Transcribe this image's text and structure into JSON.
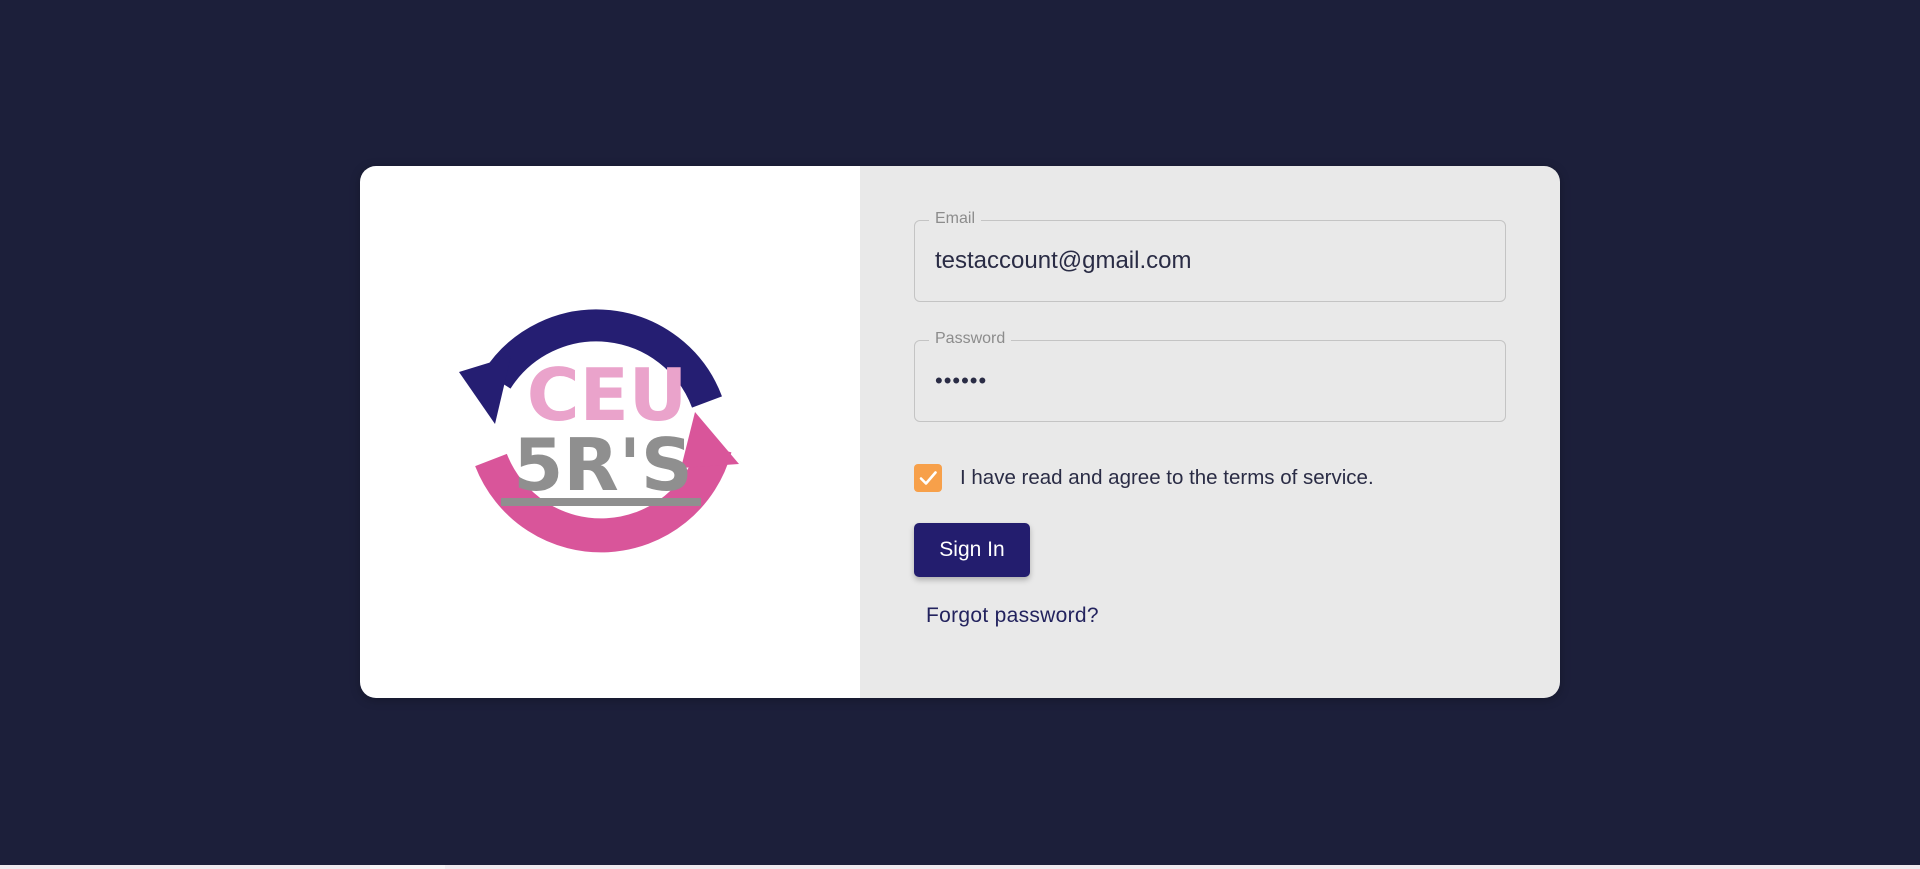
{
  "login": {
    "email": {
      "label": "Email",
      "value": "testaccount@gmail.com"
    },
    "password": {
      "label": "Password",
      "value": "••••••"
    },
    "terms": {
      "checked": true,
      "text": "I have read and agree to the terms of service."
    },
    "sign_in_label": "Sign In",
    "forgot_password_label": "Forgot password?"
  },
  "logo": {
    "line1": "CEU",
    "line2": "5R'S"
  },
  "colors": {
    "background": "#1c1f3a",
    "primary": "#231d6e",
    "accent_checkbox": "#f7a04a",
    "logo_navy": "#251e72",
    "logo_pink": "#d9559a",
    "logo_light_pink": "#eaa3cb",
    "logo_gray": "#8f8f8f"
  }
}
